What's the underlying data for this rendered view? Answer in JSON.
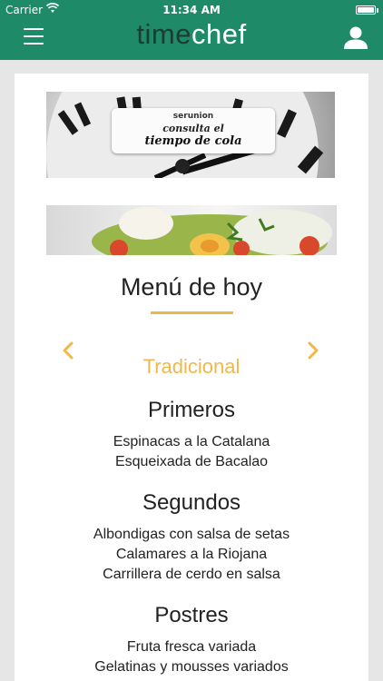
{
  "status_bar": {
    "carrier": "Carrier",
    "time": "11:34 AM"
  },
  "header": {
    "logo_time": "time",
    "logo_chef": "chef"
  },
  "banner": {
    "brand": "serunion",
    "line1": "consulta el",
    "line2": "tiempo de cola"
  },
  "menu": {
    "title": "Menú de hoy",
    "category": "Tradicional",
    "sections": [
      {
        "title": "Primeros",
        "items": [
          "Espinacas a la Catalana",
          "Esqueixada de Bacalao"
        ]
      },
      {
        "title": "Segundos",
        "items": [
          "Albondigas con salsa de setas",
          "Calamares a la Riojana",
          "Carrillera de cerdo en salsa"
        ]
      },
      {
        "title": "Postres",
        "items": [
          "Fruta fresca variada",
          "Gelatinas y mousses variados"
        ]
      }
    ]
  },
  "colors": {
    "brand_green": "#1f8a68",
    "accent": "#f0b84a"
  }
}
